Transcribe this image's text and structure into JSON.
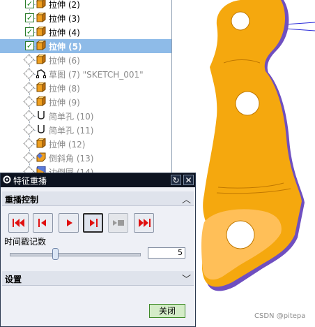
{
  "tree": {
    "items": [
      {
        "label": "拉伸 (2)",
        "state": "checked",
        "icon": "extrude-icon",
        "status": "active"
      },
      {
        "label": "拉伸 (3)",
        "state": "checked",
        "icon": "extrude-icon",
        "status": "active"
      },
      {
        "label": "拉伸 (4)",
        "state": "checked",
        "icon": "extrude-icon",
        "status": "active"
      },
      {
        "label": "拉伸 (5)",
        "state": "checked",
        "icon": "extrude-icon",
        "status": "selected"
      },
      {
        "label": "拉伸 (6)",
        "state": "unchecked",
        "icon": "extrude-icon",
        "status": "inactive"
      },
      {
        "label": "草图 (7) \"SKETCH_001\"",
        "state": "unchecked",
        "icon": "sketch-icon",
        "status": "inactive"
      },
      {
        "label": "拉伸 (8)",
        "state": "unchecked",
        "icon": "extrude-icon",
        "status": "inactive"
      },
      {
        "label": "拉伸 (9)",
        "state": "unchecked",
        "icon": "extrude-icon",
        "status": "inactive"
      },
      {
        "label": "简单孔 (10)",
        "state": "unchecked",
        "icon": "hole-icon",
        "status": "inactive"
      },
      {
        "label": "简单孔 (11)",
        "state": "unchecked",
        "icon": "hole-icon",
        "status": "inactive"
      },
      {
        "label": "拉伸 (12)",
        "state": "unchecked",
        "icon": "extrude-icon",
        "status": "inactive"
      },
      {
        "label": "倒斜角 (13)",
        "state": "unchecked",
        "icon": "chamfer-icon",
        "status": "inactive"
      },
      {
        "label": "边倒圆 (14)",
        "state": "unchecked",
        "icon": "blend-icon",
        "status": "inactive"
      }
    ]
  },
  "dialog": {
    "title": "特征重播",
    "replay_section": "重播控制",
    "slider_label": "时间戳记数",
    "time_stamp_value": "5",
    "slider_position": 0.35,
    "settings_section": "设置",
    "close_label": "关闭",
    "buttons": [
      {
        "name": "rewind-to-start-button",
        "icon": "first-icon"
      },
      {
        "name": "step-back-button",
        "icon": "previous-icon"
      },
      {
        "name": "play-button",
        "icon": "play-icon"
      },
      {
        "name": "step-forward-button",
        "icon": "next-step-icon"
      },
      {
        "name": "replay-feature-button",
        "icon": "replay-feature-icon",
        "disabled": true
      },
      {
        "name": "fast-forward-to-end-button",
        "icon": "last-icon"
      }
    ]
  },
  "colors": {
    "model_orange": "#f5a80e",
    "model_shadow": "#7a52c8",
    "selected_row": "#8ebbe8",
    "title_bar": "#0d1320",
    "close_button": "#d4ecc8"
  },
  "watermark": "CSDN @pitepa"
}
